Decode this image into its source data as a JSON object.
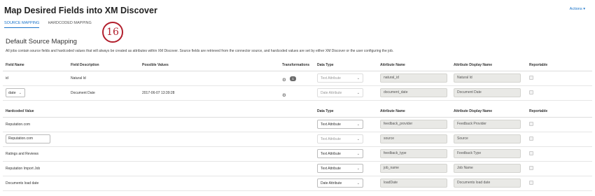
{
  "header": {
    "title": "Map Desired Fields into XM Discover",
    "actions_label": "Actions ▾"
  },
  "tabs": [
    {
      "label": "SOURCE MAPPING",
      "active": true
    },
    {
      "label": "HARDCODED MAPPING",
      "active": false
    }
  ],
  "step_badge": "16",
  "section": {
    "title": "Default Source Mapping",
    "description": "All jobs contain source fields and hardcoded values that will always be created as attributes within XM Discover. Source fields are retrieved from the connector source, and hardcoded values are set by either XM Discover or the user configuring the job."
  },
  "source_table": {
    "headers": {
      "field_name": "Field Name",
      "field_description": "Field Description",
      "possible_values": "Possible Values",
      "transformations": "Transformations",
      "data_type": "Data Type",
      "attribute_name": "Attribute Name",
      "attribute_display_name": "Attribute Display Name",
      "reportable": "Reportable"
    },
    "rows": [
      {
        "field_name": "id",
        "field_description": "Natural Id",
        "possible_values": "",
        "transform_count": "1",
        "data_type": "Text Attribute",
        "attribute_name": "natural_id",
        "attribute_display_name": "Natural Id"
      },
      {
        "field_name": "date",
        "field_description": "Document Date",
        "possible_values": "2017-06-07 13:39:28",
        "transform_count": "",
        "data_type": "Date Attribute",
        "attribute_name": "document_date",
        "attribute_display_name": "Document Date"
      }
    ]
  },
  "hardcoded_table": {
    "headers": {
      "hardcoded_value": "Hardcoded Value",
      "data_type": "Data Type",
      "attribute_name": "Attribute Name",
      "attribute_display_name": "Attribute Display Name",
      "reportable": "Reportable"
    },
    "rows": [
      {
        "value": "Reputation.com",
        "data_type": "Text Attribute",
        "attribute_name": "feedback_provider",
        "attribute_display_name": "Feedback Provider"
      },
      {
        "value": "Reputation.com",
        "data_type": "Text Attribute",
        "attribute_name": "source",
        "attribute_display_name": "Source"
      },
      {
        "value": "Ratings and Reviews",
        "data_type": "Text Attribute",
        "attribute_name": "feedback_type",
        "attribute_display_name": "Feedback Type"
      },
      {
        "value": "Reputation Import Job",
        "data_type": "Text Attribute",
        "attribute_name": "job_name",
        "attribute_display_name": "Job Name"
      },
      {
        "value": "Documents load date",
        "data_type": "Date Attribute",
        "attribute_name": "loadDate",
        "attribute_display_name": "Documents load date"
      }
    ]
  },
  "colors": {
    "accent": "#1a73c9",
    "step_badge": "#b21f2d",
    "readonly_bg": "#e9e9e6"
  },
  "icons": {
    "gear": "gear-icon",
    "chevron": "chevron-down-icon"
  }
}
